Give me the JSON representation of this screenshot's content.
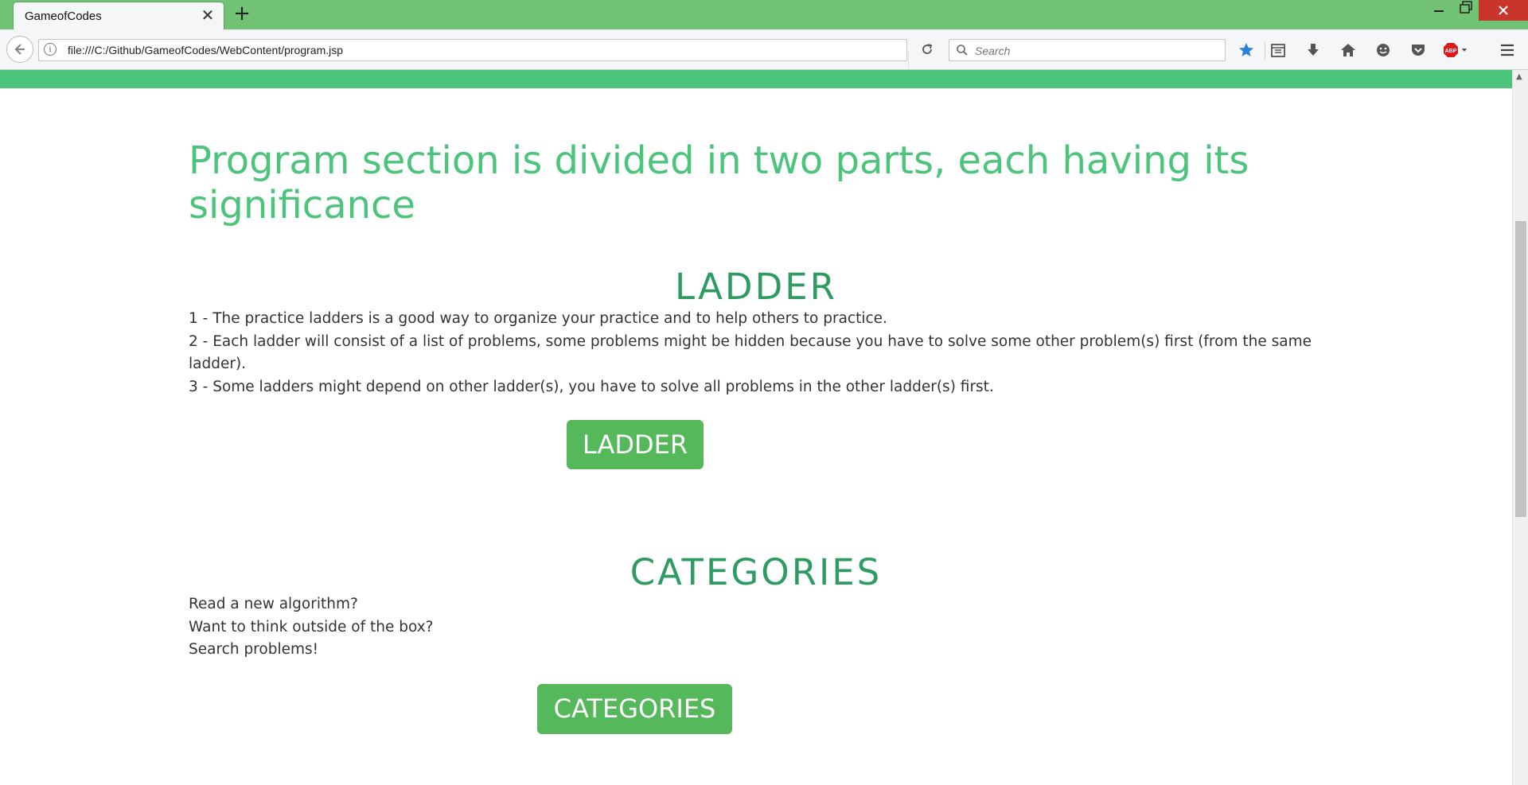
{
  "browser": {
    "tab_title": "GameofCodes",
    "tab_close": "✕",
    "new_tab": "+",
    "url": "file:///C:/Github/GameofCodes/WebContent/program.jsp",
    "search_placeholder": "Search",
    "toolbar_icons": [
      "bookmark-star-icon",
      "reading-list-icon",
      "download-icon",
      "home-icon",
      "feedback-icon",
      "pocket-icon",
      "adblock-icon",
      "menu-icon"
    ],
    "accent": "#72c375"
  },
  "page": {
    "heading": "Program section is divided in two parts, each having its significance",
    "ladder": {
      "title": "LADDER",
      "lines": [
        "1 - The practice ladders is a good way to organize your practice and to help others to practice.",
        "2 - Each ladder will consist of a list of problems, some problems might be hidden because you have to solve some other problem(s) first (from the same ladder).",
        "3 - Some ladders might depend on other ladder(s), you have to solve all problems in the other ladder(s) first."
      ],
      "button": "LADDER"
    },
    "categories": {
      "title": "CATEGORIES",
      "lines": [
        "Read a new algorithm?",
        "Want to think outside of the box?",
        "Search problems!"
      ],
      "button": "CATEGORIES"
    },
    "colors": {
      "heading": "#4cc47b",
      "section_title": "#2e9b63",
      "button": "#55b85a"
    }
  }
}
